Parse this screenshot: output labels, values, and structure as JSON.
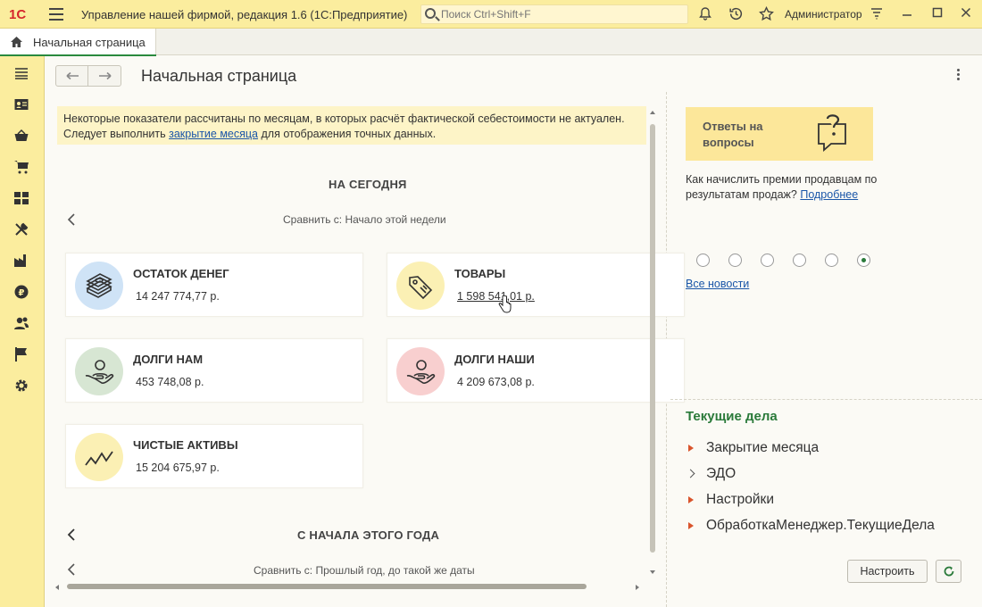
{
  "titlebar": {
    "logo": "1С",
    "app_title": "Управление нашей фирмой, редакция 1.6  (1С:Предприятие)",
    "search_placeholder": "Поиск Ctrl+Shift+F",
    "user": "Администратор"
  },
  "tab": {
    "label": "Начальная страница"
  },
  "page": {
    "title": "Начальная страница",
    "notice": {
      "line1": "Некоторые показатели рассчитаны по месяцам, в которых расчёт фактической себестоимости не актуален.",
      "line2_before": "Следует выполнить ",
      "line2_link": "закрытие месяца",
      "line2_after": " для отображения точных данных."
    },
    "today": {
      "title": "НА СЕГОДНЯ",
      "compare": "Сравнить с: Начало этой недели",
      "cards": [
        {
          "title": "ОСТАТОК ДЕНЕГ",
          "value": "14 247 774,77 р.",
          "icon": "money-stack-icon"
        },
        {
          "title": "ТОВАРЫ",
          "value": "1 598 541,01 р.",
          "icon": "price-tag-icon"
        },
        {
          "title": "ДОЛГИ НАМ",
          "value": "453 748,08 р.",
          "icon": "hand-person-icon"
        },
        {
          "title": "ДОЛГИ НАШИ",
          "value": "4 209 673,08 р.",
          "icon": "hand-person-icon"
        },
        {
          "title": "ЧИСТЫЕ АКТИВЫ",
          "value": "15 204 675,97 р.",
          "icon": "trend-line-icon"
        }
      ]
    },
    "year": {
      "title": "С НАЧАЛА ЭТОГО ГОДА",
      "compare": "Сравнить с: Прошлый год, до такой же даты"
    }
  },
  "right": {
    "faq_card": "Ответы на вопросы",
    "faq_text": "Как начислить премии продавцам по результатам продаж?",
    "faq_link": "Подробнее",
    "all_news": "Все новости",
    "tasks_title": "Текущие дела",
    "tasks": [
      "Закрытие месяца",
      "ЭДО",
      "Настройки",
      "ОбработкаМенеджер.ТекущиеДела"
    ],
    "configure_button": "Настроить"
  },
  "colors": {
    "accent_green": "#2a7a3a",
    "titlebar_yellow": "#fbed9e",
    "card_blue": "#cfe3f6",
    "card_yellow": "#fbf0b4",
    "card_green": "#d7e6d3",
    "card_pink": "#f8cfcf"
  }
}
